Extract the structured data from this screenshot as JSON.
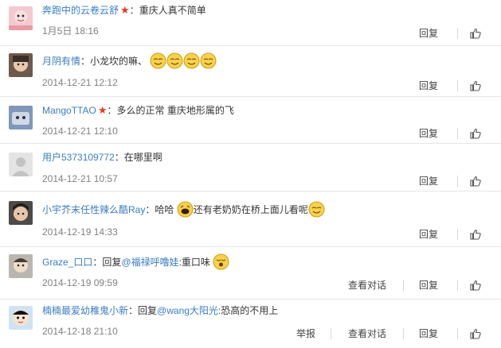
{
  "actions": {
    "reply": "回复",
    "view_conversation": "查看对话",
    "report": "举报"
  },
  "comments": [
    {
      "user": "奔跑中的云卷云舒",
      "colon": "：",
      "text": "重庆人真不简单",
      "date": "1月5日 18:16"
    },
    {
      "user": "月阴有情",
      "colon": "：",
      "text": "小龙坎的嘛、",
      "date": "2014-12-21 12:12"
    },
    {
      "user": "MangoTTAO",
      "colon": "：",
      "text": "多么的正常 重庆地形属的飞",
      "date": "2014-12-21 12:10"
    },
    {
      "user": "用户5373109772",
      "colon": "：",
      "text": "在哪里啊",
      "date": "2014-12-21 10:57"
    },
    {
      "user": "小宇芥末任性辣么酷Ray",
      "colon": "：",
      "text_a": "哈哈",
      "text_b": "还有老奶奶在桥上面儿看呢",
      "date": "2014-12-19 14:33"
    },
    {
      "user": "Graze_口口",
      "colon": "：",
      "prefix": "回复",
      "mention": "@福禄呼噜娃",
      "text": ":重口味",
      "date": "2014-12-19 09:59"
    },
    {
      "user": "楠楠最爱幼稚鬼小新",
      "colon": "：",
      "prefix": "回复",
      "mention": "@wang大阳光",
      "text": ":恐高的不用上",
      "date": "2014-12-18 21:10"
    }
  ],
  "icons": {
    "like": "thumbs-up-icon",
    "verified": "red-star-icon",
    "emoji": "smiley-emoji-icon"
  },
  "colors": {
    "link": "#3a7dc2",
    "star": "#e9391c",
    "date": "#808080",
    "divider": "#e6e6e6"
  }
}
